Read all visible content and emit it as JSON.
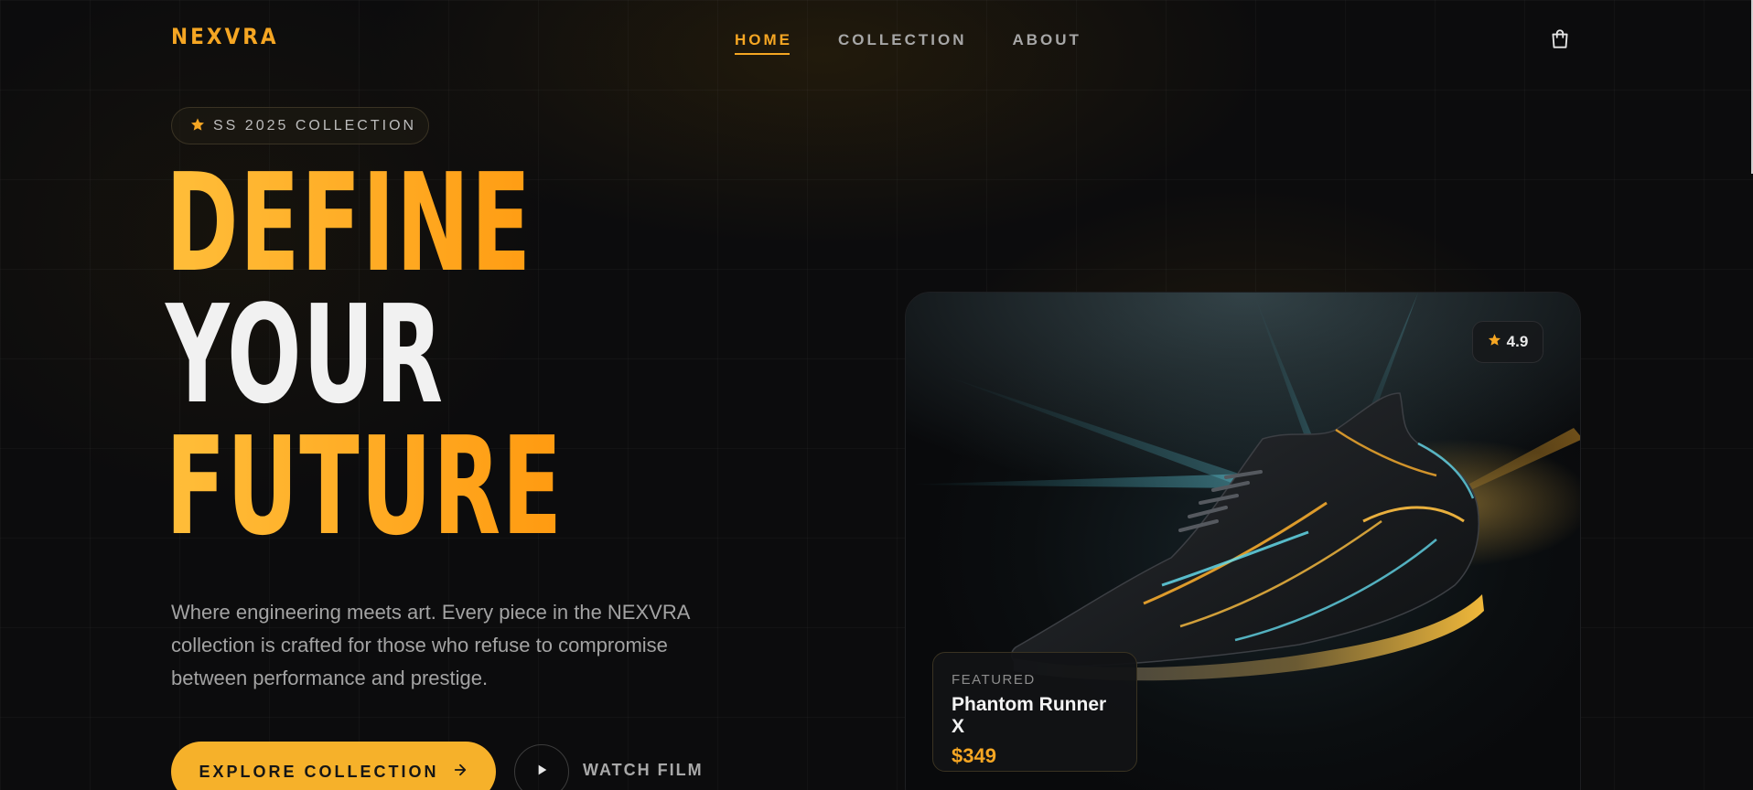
{
  "brand": {
    "logo": "NEXVRA",
    "accent": "#f5a623"
  },
  "nav": {
    "links": [
      {
        "label": "HOME",
        "active": true
      },
      {
        "label": "COLLECTION",
        "active": false
      },
      {
        "label": "ABOUT",
        "active": false
      }
    ],
    "cart_icon": "shopping-bag-icon"
  },
  "hero": {
    "badge": {
      "icon": "star-icon",
      "text": "SS 2025 COLLECTION"
    },
    "headline": [
      "DEFINE",
      "YOUR",
      "FUTURE"
    ],
    "description": "Where engineering meets art. Every piece in the NEXVRA collection is crafted for those who refuse to compromise between performance and prestige.",
    "primary_cta": {
      "label": "EXPLORE COLLECTION",
      "icon": "arrow-right-icon"
    },
    "secondary_cta": {
      "label": "WATCH FILM",
      "icon": "play-icon"
    }
  },
  "product": {
    "rating": "4.9",
    "rating_icon": "star-icon",
    "label": "FEATURED",
    "name": "Phantom Runner X",
    "price": "$349"
  }
}
